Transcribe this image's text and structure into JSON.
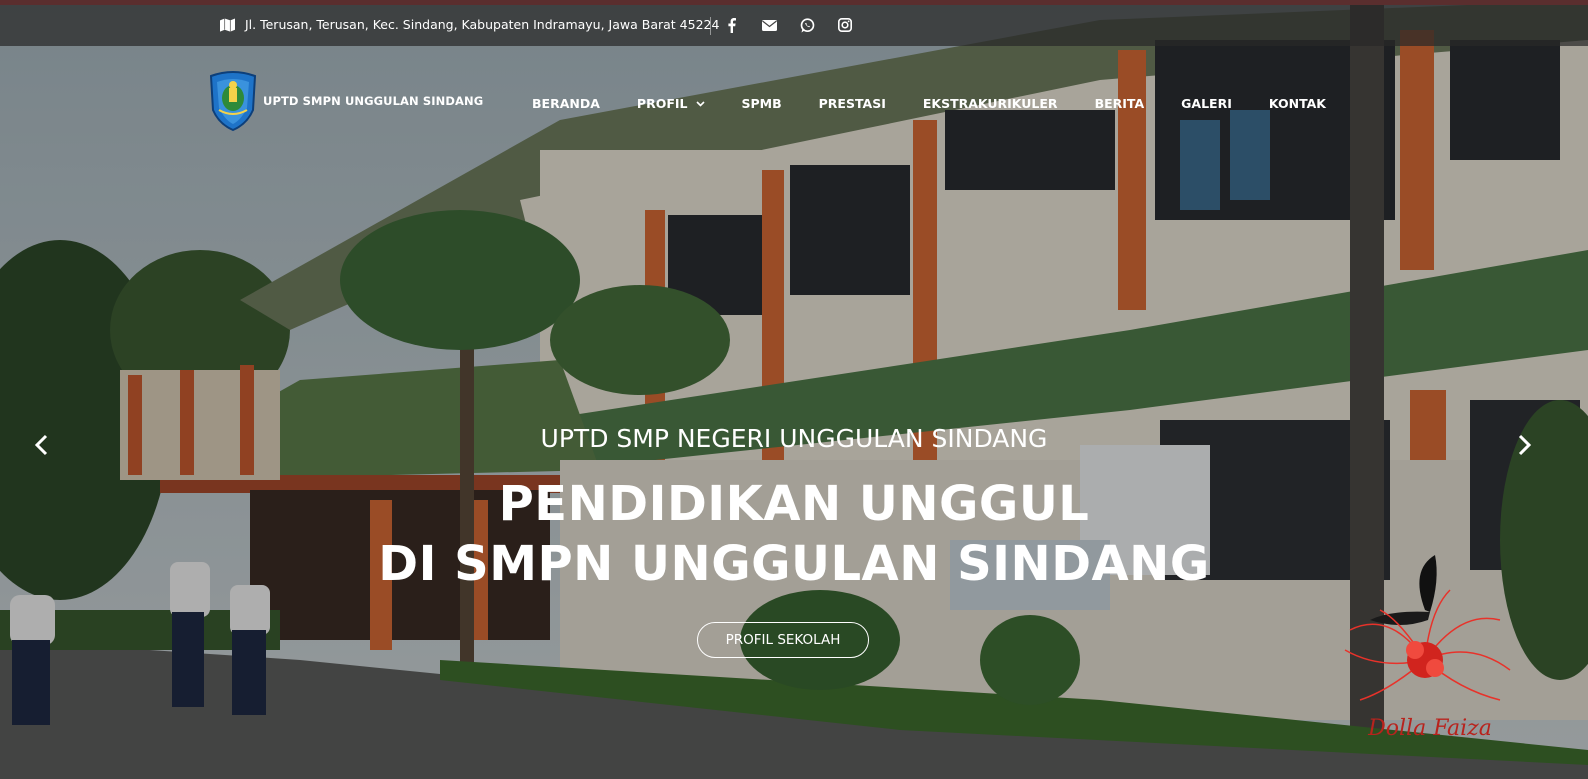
{
  "topbar": {
    "address": "Jl. Terusan, Terusan, Kec. Sindang, Kabupaten Indramayu, Jawa Barat 45224",
    "address_icon": "map-icon",
    "social": [
      "facebook-icon",
      "envelope-icon",
      "whatsapp-icon",
      "instagram-icon"
    ]
  },
  "header": {
    "logo_text": "UPTD SMPN UNGGULAN SINDANG",
    "nav": [
      "BERANDA",
      "PROFIL",
      "SPMB",
      "PRESTASI",
      "EKSTRAKURIKULER",
      "BERITA",
      "GALERI",
      "KONTAK"
    ]
  },
  "hero": {
    "subtitle": "UPTD SMP NEGERI UNGGULAN SINDANG",
    "title_line1": "PENDIDIKAN UNGGUL",
    "title_line2": "DI SMPN UNGGULAN SINDANG",
    "button": "PROFIL SEKOLAH",
    "watermark": "Dolla Faiza"
  },
  "colors": {
    "accent_red": "#e8322a",
    "wall": "#e9e4d6",
    "pillar": "#d66a35",
    "roof_green": "#4f7a4a"
  }
}
